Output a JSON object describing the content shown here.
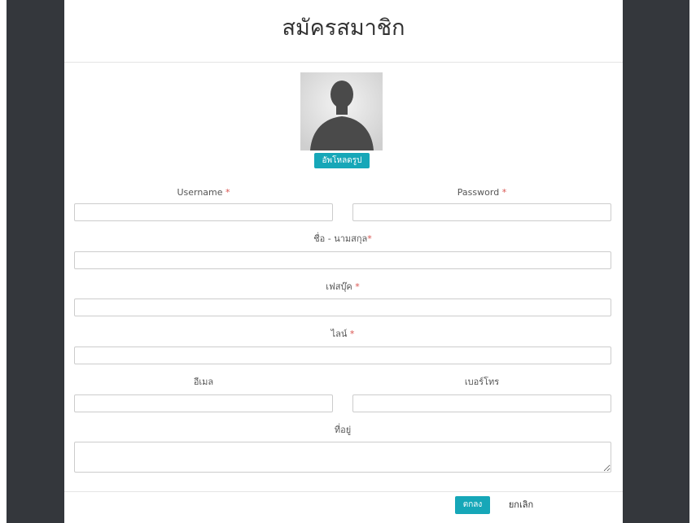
{
  "modal": {
    "title": "สมัครสมาชิก",
    "upload_label": "อัพโหลดรูป",
    "fields": {
      "username_label": "Username",
      "password_label": "Password",
      "fullname_label": "ชื่อ - นามสกุล",
      "facebook_label": "เฟสบุ๊ค",
      "line_label": "ไลน์",
      "email_label": "อีเมล",
      "phone_label": "เบอร์โทร",
      "address_label": "ที่อยู่",
      "required_mark": "*"
    },
    "buttons": {
      "ok_label": "ตกลง",
      "cancel_label": "ยกเลิก"
    }
  },
  "colors": {
    "accent": "#16a7b8",
    "required": "#d9534f",
    "backdrop": "#34373c"
  },
  "icons": {
    "avatar": "person-silhouette-icon"
  }
}
